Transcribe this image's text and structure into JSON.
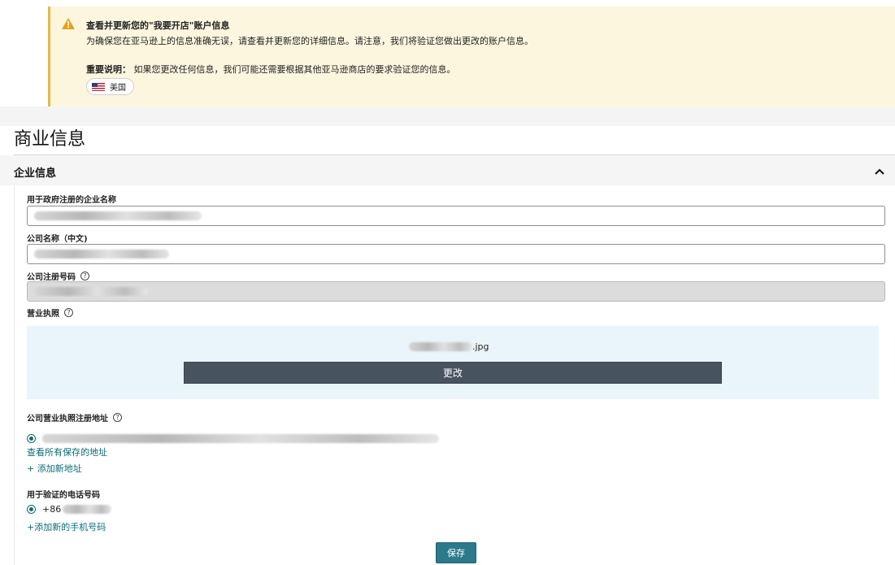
{
  "notice": {
    "title": "查看并更新您的\"我要开店\"账户信息",
    "description": "为确保您在亚马逊上的信息准确无误，请查看并更新您的详细信息。请注意，我们将验证您做出更改的账户信息。",
    "important_label": "重要说明：",
    "important_text": "如果您更改任何信息，我们可能还需要根据其他亚马逊商店的要求验证您的信息。",
    "country": "美国",
    "icon": "warning-icon",
    "accent_color": "#e8b64a"
  },
  "page": {
    "title": "商业信息"
  },
  "section": {
    "title": "企业信息",
    "toggle_icon": "chevron-up-icon"
  },
  "fields": {
    "gov_name_label": "用于政府注册的企业名称",
    "cn_name_label": "公司名称（中文)",
    "reg_no_label": "公司注册号码",
    "license_label": "营业执照",
    "address_label": "公司营业执照注册地址",
    "phone_label": "用于验证的电话号码"
  },
  "upload": {
    "file_ext": ".jpg",
    "change_button": "更改"
  },
  "links": {
    "view_saved_addresses": "查看所有保存的地址",
    "add_address": "+ 添加新地址",
    "add_phone": "+添加新的手机号码"
  },
  "phone": {
    "prefix": "+86"
  },
  "actions": {
    "save_button": "保存"
  },
  "colors": {
    "link": "#0a6b74",
    "primary_button": "#2b7a8c",
    "secondary_button": "#47535e",
    "upload_bg": "#eaf4fb"
  }
}
